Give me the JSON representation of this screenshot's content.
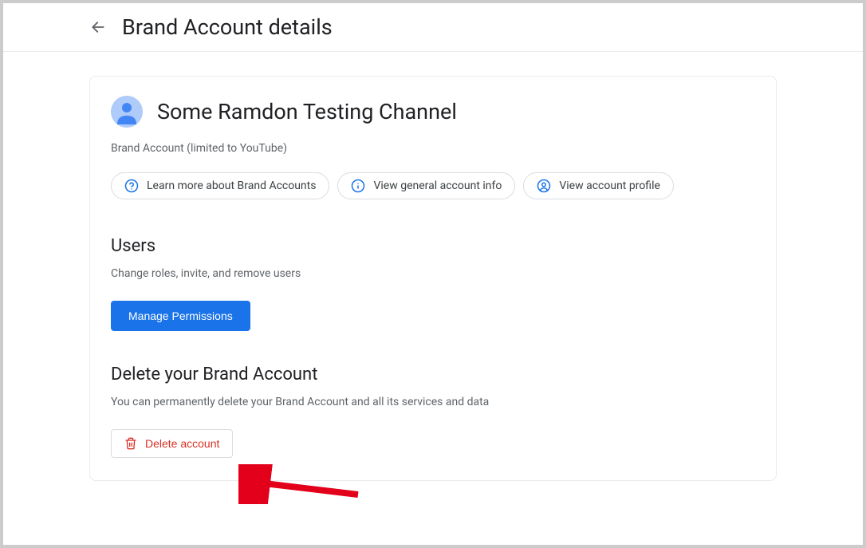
{
  "header": {
    "title": "Brand Account details"
  },
  "card": {
    "account_name": "Some Ramdon Testing Channel",
    "account_subtext": "Brand Account (limited to YouTube)",
    "chips": {
      "learn_more": "Learn more about Brand Accounts",
      "general_info": "View general account info",
      "profile": "View account profile"
    },
    "users_section": {
      "title": "Users",
      "subtitle": "Change roles, invite, and remove users",
      "button_label": "Manage Permissions"
    },
    "delete_section": {
      "title": "Delete your Brand Account",
      "subtitle": "You can permanently delete your Brand Account and all its services and data",
      "button_label": "Delete account"
    }
  }
}
